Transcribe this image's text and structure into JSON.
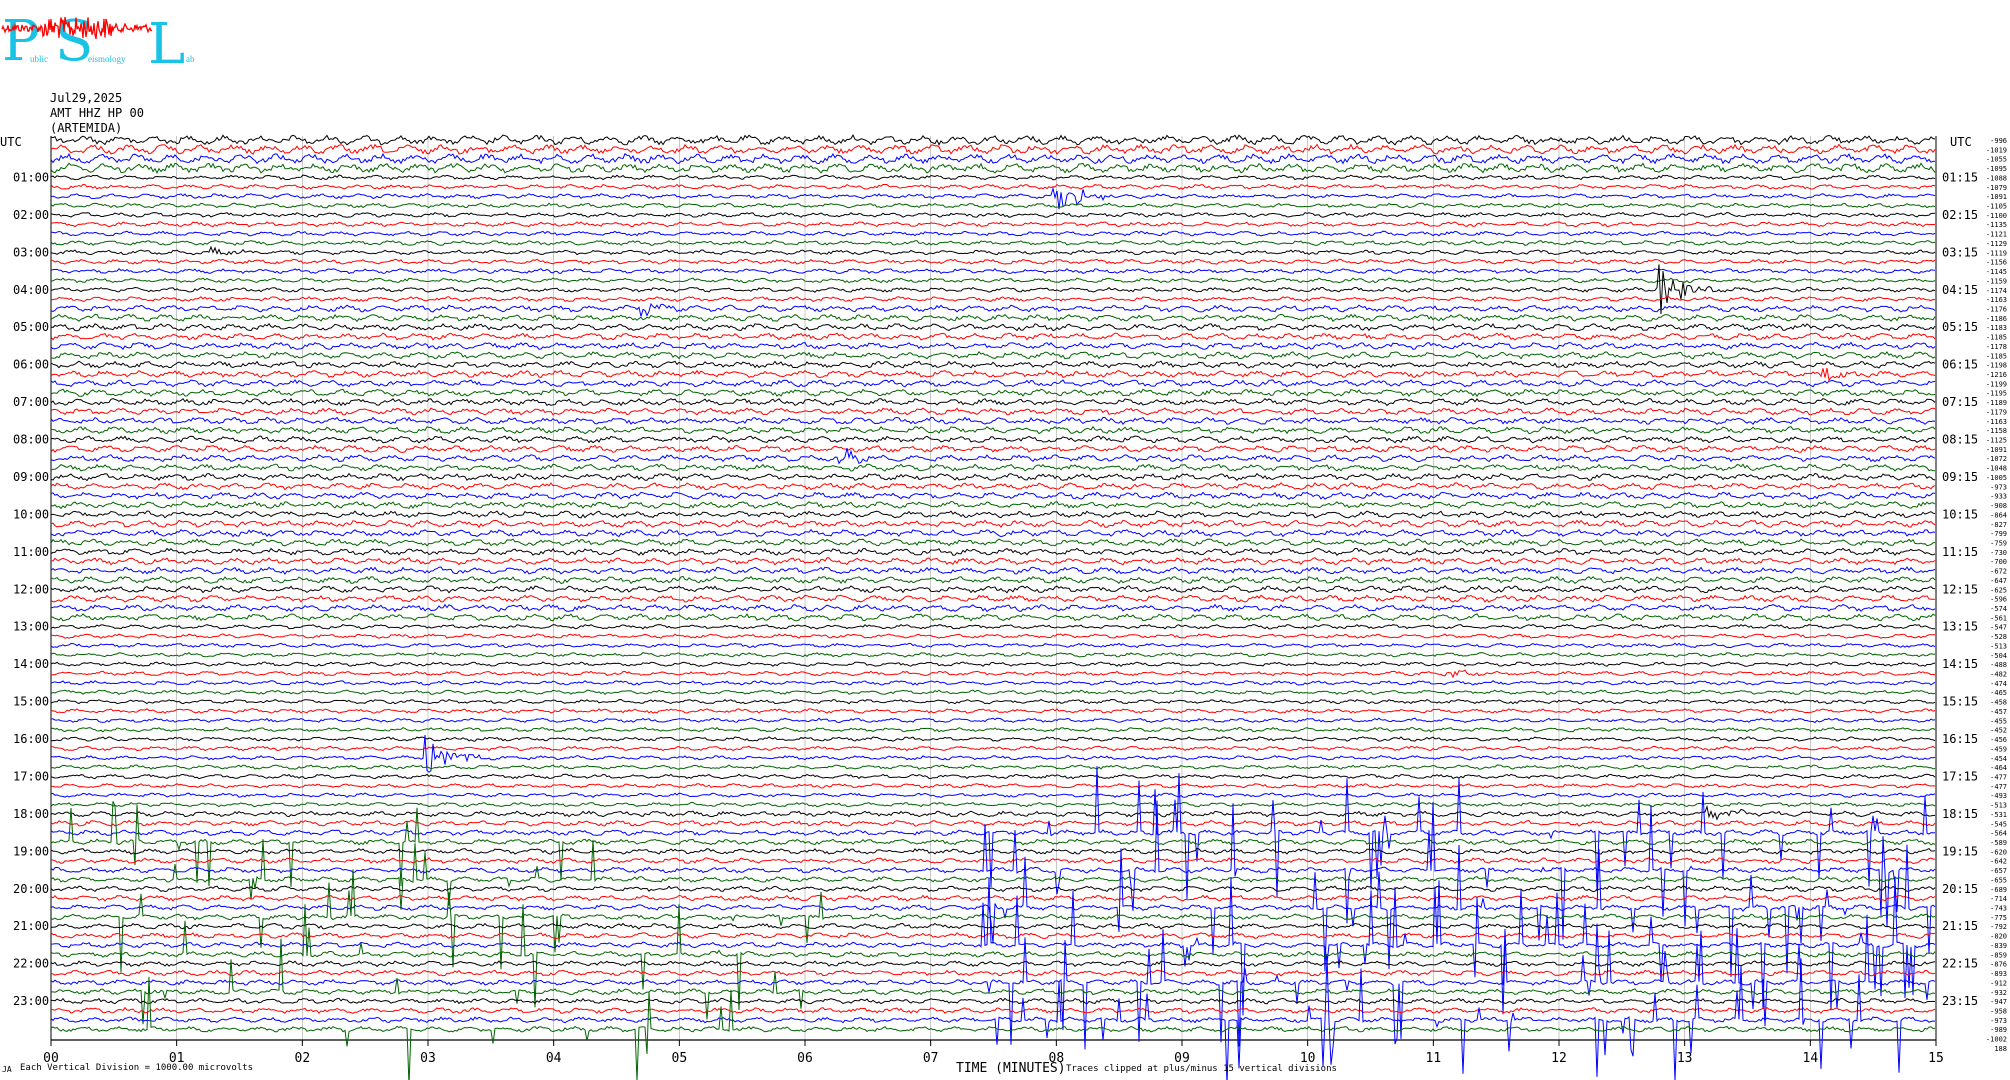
{
  "header": {
    "logo_letters": [
      "P",
      "S",
      "L"
    ],
    "logo_small": [
      "ublic",
      "eismology",
      "ab"
    ],
    "date": "Jul29,2025",
    "station": "AMT HHZ HP 00",
    "site": "(ARTEMIDA)"
  },
  "footer": {
    "scale_note": "Each Vertical Division = 1000.00 microvolts",
    "x_axis_title": "TIME (MINUTES)",
    "clip_note": "Traces clipped at plus/minus 15 vertical divisions",
    "corner_mark": "JA"
  },
  "colors": {
    "trace_cycle": [
      "#000000",
      "#ff0000",
      "#0000ff",
      "#006400"
    ],
    "grid": "#000000",
    "logo_cyan": "#19c3e6",
    "logo_red": "#ff0000"
  },
  "chart_data": {
    "type": "line",
    "title": "",
    "x_label": "TIME (MINUTES)",
    "x_range": [
      0,
      15
    ],
    "x_ticks": [
      "00",
      "01",
      "02",
      "03",
      "04",
      "05",
      "06",
      "07",
      "08",
      "09",
      "10",
      "11",
      "12",
      "13",
      "14",
      "15"
    ],
    "left_axis_title": "UTC",
    "right_axis_title": "UTC",
    "left_hour_labels": [
      "01:00",
      "02:00",
      "03:00",
      "04:00",
      "05:00",
      "06:00",
      "07:00",
      "08:00",
      "09:00",
      "10:00",
      "11:00",
      "12:00",
      "13:00",
      "14:00",
      "15:00",
      "16:00",
      "17:00",
      "18:00",
      "19:00",
      "20:00",
      "21:00",
      "22:00",
      "23:00"
    ],
    "right_hour_labels": [
      "01:15",
      "02:15",
      "03:15",
      "04:15",
      "05:15",
      "06:15",
      "07:15",
      "08:15",
      "09:15",
      "10:15",
      "11:15",
      "12:15",
      "13:15",
      "14:15",
      "15:15",
      "16:15",
      "17:15",
      "18:15",
      "19:15",
      "20:15",
      "21:15",
      "22:15",
      "23:15"
    ],
    "trace_count": 96,
    "minutes_per_trace": 15,
    "trace_offsets": [
      "-996",
      "-1019",
      "-1055",
      "-1095",
      "-1088",
      "-1079",
      "-1091",
      "-1105",
      "-1100",
      "-1135",
      "-1121",
      "-1129",
      "-1119",
      "-1156",
      "-1145",
      "-1159",
      "-1174",
      "-1163",
      "-1176",
      "-1186",
      "-1183",
      "-1185",
      "-1178",
      "-1185",
      "-1198",
      "-1216",
      "-1199",
      "-1195",
      "-1189",
      "-1179",
      "-1163",
      "-1158",
      "-1125",
      "-1091",
      "-1072",
      "-1048",
      "-1005",
      "-973",
      "-933",
      "-908",
      "-864",
      "-827",
      "-799",
      "-759",
      "-730",
      "-700",
      "-672",
      "-647",
      "-625",
      "-596",
      "-574",
      "-561",
      "-547",
      "-528",
      "-513",
      "-504",
      "-488",
      "-482",
      "-474",
      "-465",
      "-458",
      "-457",
      "-455",
      "-452",
      "-456",
      "-459",
      "-454",
      "-464",
      "-477",
      "-477",
      "-493",
      "-513",
      "-531",
      "-545",
      "-564",
      "-589",
      "-620",
      "-642",
      "-657",
      "-655",
      "-689",
      "-714",
      "-743",
      "-775",
      "-792",
      "-820",
      "-839",
      "-859",
      "-876",
      "-893",
      "-912",
      "-932",
      "-947",
      "-958",
      "-973",
      "-989"
    ],
    "offset_tail": [
      "-1002",
      "188"
    ],
    "events": [
      {
        "trace": 6,
        "minute": 8.0,
        "amplitude": 3.5,
        "color": "#006400"
      },
      {
        "trace": 12,
        "minute": 1.3,
        "amplitude": 0.8,
        "color": "#ff0000"
      },
      {
        "trace": 16,
        "minute": 12.8,
        "amplitude": 5.0,
        "color": "#000000"
      },
      {
        "trace": 18,
        "minute": 4.7,
        "amplitude": 1.4,
        "color": "#0000ff"
      },
      {
        "trace": 34,
        "minute": 6.3,
        "amplitude": 1.5,
        "color": "#000000"
      },
      {
        "trace": 66,
        "minute": 3.0,
        "amplitude": 4.0,
        "color": "#0000ff"
      },
      {
        "trace": 57,
        "minute": 11.1,
        "amplitude": 0.8,
        "color": "#006400"
      },
      {
        "trace": 72,
        "minute": 13.2,
        "amplitude": 1.5,
        "color": "#000000"
      },
      {
        "trace": 25,
        "minute": 14.1,
        "amplitude": 1.3,
        "color": "#000000"
      }
    ]
  }
}
